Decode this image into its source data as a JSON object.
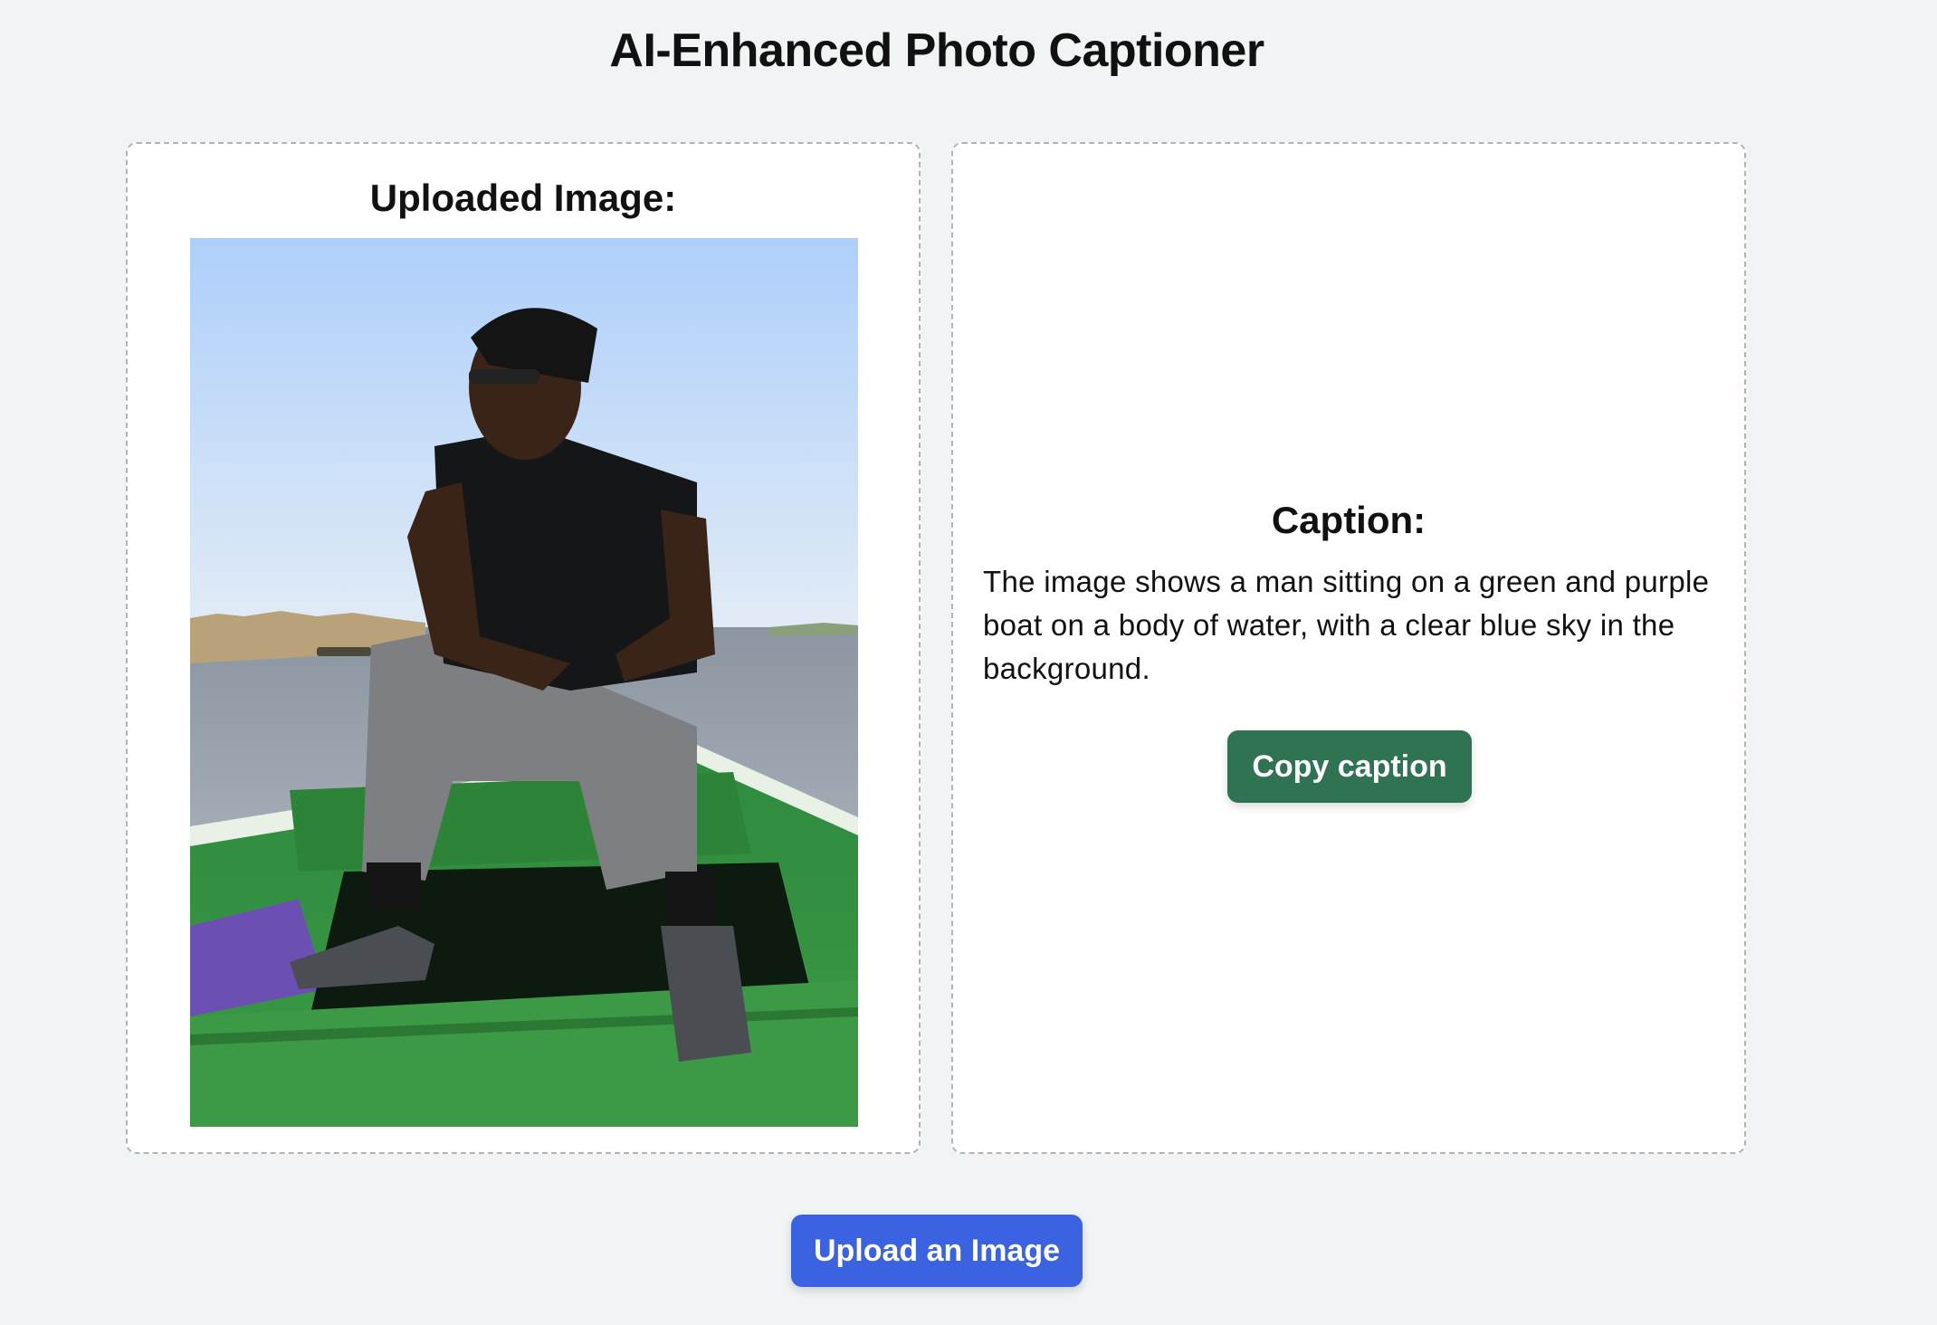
{
  "app": {
    "title": "AI-Enhanced Photo Captioner"
  },
  "uploaded_panel": {
    "heading": "Uploaded Image:",
    "image_alt": "Uploaded photo"
  },
  "caption_panel": {
    "heading": "Caption:",
    "caption": "The image shows a man sitting on a green and purple boat on a body of water, with a clear blue sky in the background.",
    "copy_label": "Copy caption"
  },
  "actions": {
    "upload_label": "Upload an Image"
  },
  "colors": {
    "background": "#f1f4f5",
    "copy_button": "#2f7353",
    "upload_button": "#3b62e0"
  }
}
